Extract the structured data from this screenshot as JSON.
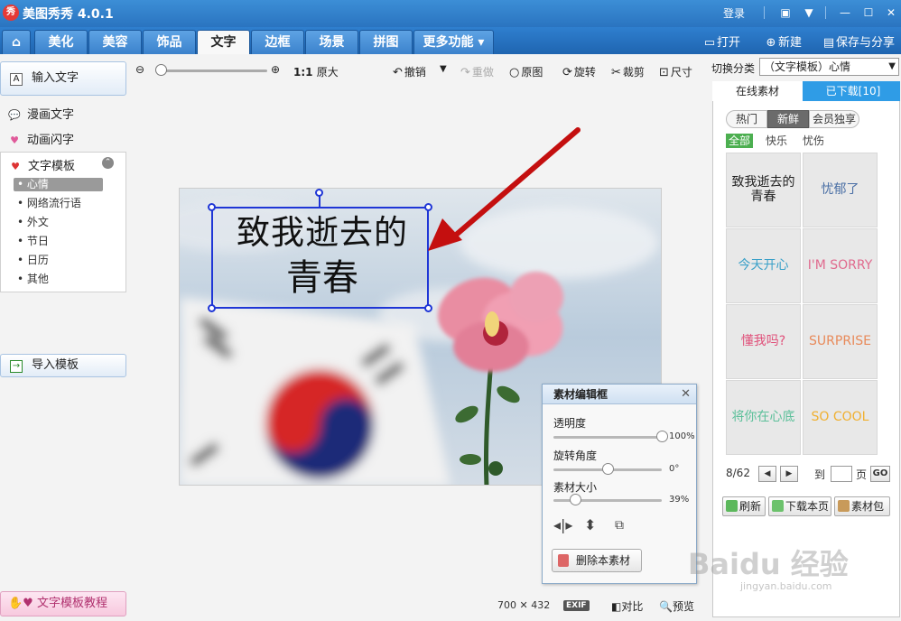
{
  "titlebar": {
    "logo_text": "秀",
    "app_title": "美图秀秀 4.0.1",
    "login": "登录"
  },
  "nav": {
    "tabs": [
      {
        "label": "美化"
      },
      {
        "label": "美容"
      },
      {
        "label": "饰品"
      },
      {
        "label": "文字"
      },
      {
        "label": "边框"
      },
      {
        "label": "场景"
      },
      {
        "label": "拼图"
      },
      {
        "label": "更多功能 ▾"
      }
    ],
    "active_tab": "文字",
    "open_label": "打开",
    "new_label": "新建",
    "save_share_label": "保存与分享"
  },
  "sidebar": {
    "input_text": "输入文字",
    "comic_text": "漫画文字",
    "animated_text": "动画闪字",
    "template_header": "文字模板",
    "template_items": [
      "心情",
      "网络流行语",
      "外文",
      "节日",
      "日历",
      "其他"
    ],
    "active_template": "心情",
    "import_template": "导入模板",
    "tutorial": "文字模板教程"
  },
  "toolbar": {
    "zoom_one_to_one": "1:1",
    "original_size": "原大",
    "undo": "撤销",
    "redo": "重做",
    "original_image": "原图",
    "rotate": "旋转",
    "crop": "裁剪",
    "size": "尺寸"
  },
  "canvas": {
    "text_line1": "致我逝去的",
    "text_line2": "青春",
    "image_width": "700",
    "image_height": "432",
    "exif": "EXIF",
    "compare": "对比",
    "preview": "预览"
  },
  "editor": {
    "title": "素材编辑框",
    "opacity_label": "透明度",
    "opacity_value": "100%",
    "opacity_level": 1.0,
    "rotation_label": "旋转角度",
    "rotation_value": "0°",
    "rotation_level": 0.5,
    "size_label": "素材大小",
    "size_value": "39%",
    "size_level": 0.2,
    "delete_label": "删除本素材"
  },
  "right_panel": {
    "switch_label": "切换分类",
    "switch_value": "（文字模板）心情",
    "tab_online": "在线素材",
    "tab_downloaded": "已下载[10]",
    "filter_pills": [
      "热门",
      "新鲜",
      "会员独享"
    ],
    "active_pill": "新鲜",
    "categories": [
      "全部",
      "快乐",
      "忧伤"
    ],
    "active_category": "全部",
    "thumbnails": [
      {
        "text": "致我逝去的 青春",
        "color": "#222222"
      },
      {
        "text": "忧郁了",
        "color": "#4a6fa5"
      },
      {
        "text": "今天开心",
        "color": "#3aa0c8"
      },
      {
        "text": "I'M SORRY",
        "color": "#e06a8e"
      },
      {
        "text": "懂我吗?",
        "color": "#e0507a"
      },
      {
        "text": "SURPRISE",
        "color": "#e88a5a"
      },
      {
        "text": "将你在心底",
        "color": "#5cc09a"
      },
      {
        "text": "SO COOL",
        "color": "#f0b030"
      }
    ],
    "page_indicator": "8/62",
    "goto_prefix": "到",
    "goto_suffix": "页",
    "go_button": "GO",
    "refresh": "刷新",
    "download_page": "下载本页",
    "material_pack": "素材包"
  },
  "watermark": {
    "brand": "Baidu 经验",
    "sub": "jingyan.baidu.com"
  },
  "colors": {
    "title_bar": "#2a74c0",
    "nav_bar": "#1f65b0",
    "tab_active_bg": "#2f9ce6",
    "arrow_red": "#c40f0f",
    "selection_blue": "#1f36d6"
  },
  "icons": {
    "home": "home-icon",
    "zoom_out": "zoom-out-icon",
    "zoom_in": "zoom-in-icon",
    "undo": "undo-icon",
    "redo": "redo-icon",
    "rotate": "rotate-icon",
    "crop": "scissors-icon",
    "size": "resize-icon",
    "close": "close-icon"
  }
}
